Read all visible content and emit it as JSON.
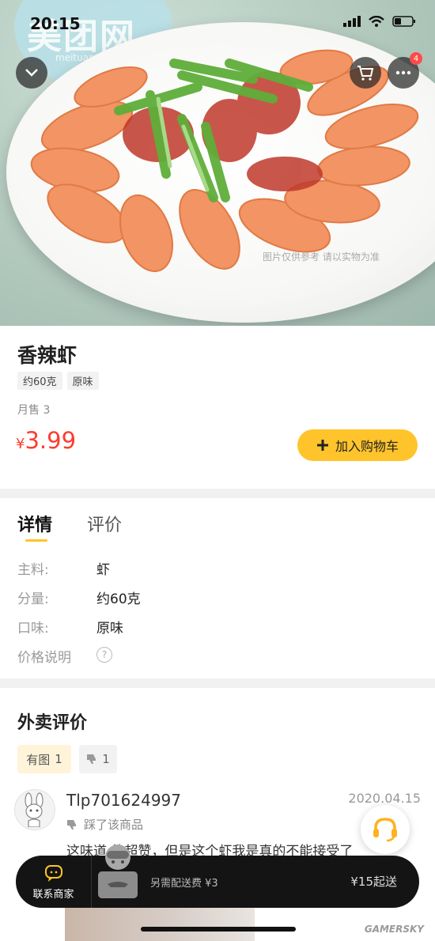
{
  "status_bar": {
    "time": "20:15"
  },
  "hero": {
    "logo_text": "美团网",
    "logo_sub": "meituan.com",
    "watermark": "图片仅供参考 请以实物为准",
    "cart_badge_count": "4"
  },
  "product": {
    "title": "香辣虾",
    "tags": [
      "约60克",
      "原味"
    ],
    "monthly_sales": "月售 3",
    "price_symbol": "¥",
    "price_value": "3.99",
    "add_to_cart_label": "加入购物车"
  },
  "details": {
    "tabs": [
      "详情",
      "评价"
    ],
    "rows": [
      {
        "label": "主料:",
        "value": "虾"
      },
      {
        "label": "分量:",
        "value": "约60克"
      },
      {
        "label": "口味:",
        "value": "原味"
      },
      {
        "label": "价格说明",
        "value": ""
      }
    ],
    "help_glyph": "?"
  },
  "reviews": {
    "title": "外卖评价",
    "filters": [
      {
        "label": "有图",
        "count": "1"
      },
      {
        "label": "",
        "count": "1"
      }
    ],
    "item": {
      "username": "Tlp701624997",
      "date": "2020.04.15",
      "verdict": "踩了该商品",
      "text": "这味道  的超赞，但是这个虾我是真的不能接受了"
    }
  },
  "bottom_bar": {
    "contact_label": "联系商家",
    "delivery_fee": "另需配送费 ¥3",
    "min_order": "¥15起送"
  },
  "watermark_site": "GAMERSKY",
  "colors": {
    "accent": "#ffc42b",
    "price": "#ff3b30",
    "bar": "#141414"
  }
}
